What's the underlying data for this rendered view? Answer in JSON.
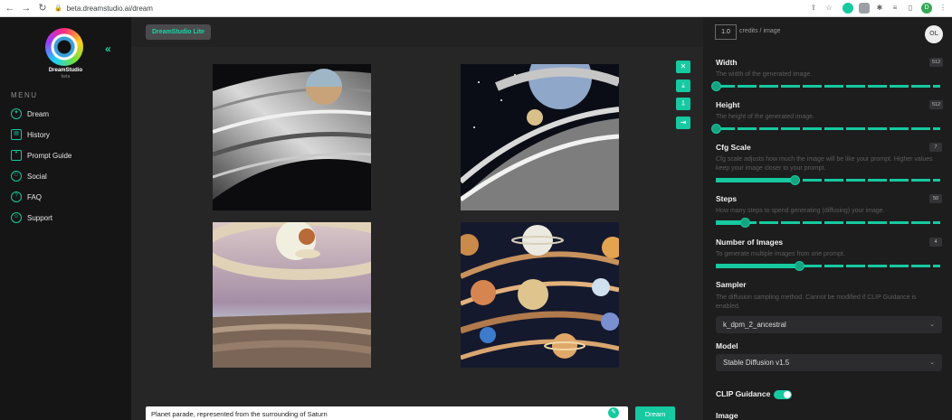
{
  "browser": {
    "url": "beta.dreamstudio.ai/dream",
    "profile_initial": "D"
  },
  "sidebar": {
    "brand": "DreamStudio",
    "brand_sub": "beta",
    "menu_title": "MENU",
    "items": [
      {
        "label": "Dream",
        "icon": "dream-icon"
      },
      {
        "label": "History",
        "icon": "history-icon"
      },
      {
        "label": "Prompt Guide",
        "icon": "prompt-guide-icon"
      },
      {
        "label": "Social",
        "icon": "social-icon"
      },
      {
        "label": "FAQ",
        "icon": "faq-icon"
      },
      {
        "label": "Support",
        "icon": "support-icon"
      }
    ]
  },
  "topbar": {
    "app_badge": "DreamStudio Lite"
  },
  "main": {
    "prompt_text": "Planet parade, represented from the surrounding of Saturn",
    "dream_button": "Dream",
    "tools": [
      "close-icon",
      "download-icon",
      "download-all-icon",
      "expand-icon"
    ],
    "images": [
      "generated-image-1",
      "generated-image-2",
      "generated-image-3",
      "generated-image-4"
    ]
  },
  "panel": {
    "credits_value": "1.0",
    "credits_label": "credits / image",
    "avatar_initials": "OL",
    "width": {
      "title": "Width",
      "value": "512",
      "desc": "The width of the generated image.",
      "level": 0.0
    },
    "height": {
      "title": "Height",
      "value": "512",
      "desc": "The height of the generated image.",
      "level": 0.0
    },
    "cfg": {
      "title": "Cfg Scale",
      "value": "7",
      "desc": "Cfg scale adjusts how much the image will be like your prompt. Higher values keep your image closer to your prompt.",
      "level": 0.35
    },
    "steps": {
      "title": "Steps",
      "value": "50",
      "desc": "How many steps to spend generating (diffusing) your image.",
      "level": 0.13
    },
    "num_images": {
      "title": "Number of Images",
      "value": "4",
      "desc": "To generate multiple images from one prompt.",
      "level": 0.37
    },
    "sampler": {
      "title": "Sampler",
      "desc": "The diffusion sampling method. Cannot be modified if CLIP Guidance is enabled.",
      "value": "k_dpm_2_ancestral"
    },
    "model": {
      "title": "Model",
      "value": "Stable Diffusion v1.5"
    },
    "clip": {
      "title": "CLIP Guidance",
      "enabled": true
    },
    "image_title": "Image"
  },
  "colors": {
    "accent": "#16c9a0",
    "background": "#262627",
    "sidebar": "#151516",
    "panel": "#1d1d1e"
  }
}
